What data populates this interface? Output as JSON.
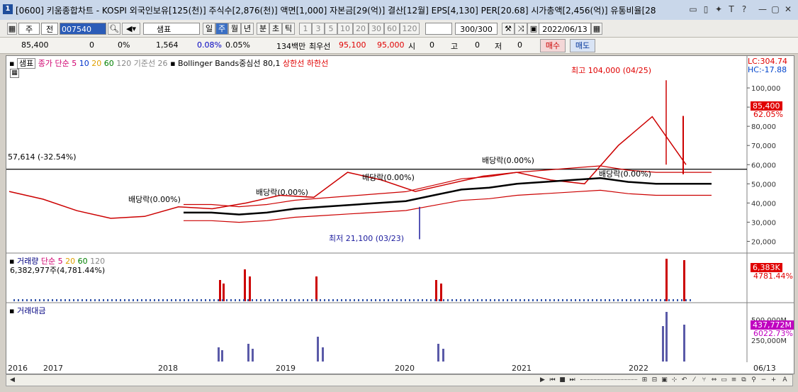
{
  "window": {
    "icon_label": "1",
    "title": "[0600] 키움종합차트 - KOSPI 외국인보유[125(천)] 주식수[2,876(천)] 액면[1,000] 자본금[29(억)] 결산[12월] EPS[4,130] PER[20.68] 시가총액[2,456(억)] 유통비율[28",
    "controls": [
      "▭",
      "▯",
      "✦",
      "T",
      "?",
      "—",
      "▢",
      "✕"
    ]
  },
  "toolbar": {
    "period_unit": "주",
    "prev_label": "전",
    "code": "007540",
    "name": "샘표",
    "period_buttons": [
      "일",
      "주",
      "월",
      "년"
    ],
    "time_buttons": [
      "분",
      "초",
      "틱"
    ],
    "number_buttons": [
      "1",
      "3",
      "5",
      "10",
      "20",
      "30",
      "60",
      "120"
    ],
    "count": "300/300",
    "date": "2022/06/13"
  },
  "quote": {
    "price": "85,400",
    "change": "0",
    "change_pct": "0%",
    "volume": "1,564",
    "vol_pct": "0.08%",
    "pct2": "0.05%",
    "amount": "134백만",
    "best_ask_label": "최우선",
    "best_ask": "95,100",
    "best_bid": "95,000",
    "open_label": "시",
    "open_val": "0",
    "high_label": "고",
    "high_val": "0",
    "low_label": "저",
    "low_val": "0",
    "buy_label": "매수",
    "sell_label": "매도"
  },
  "main_legend": {
    "name": "샘표",
    "ma_label": "종가 단순",
    "ma_periods": [
      "5",
      "10",
      "20",
      "60",
      "120"
    ],
    "base_label": "기준선 26",
    "bb_label": "Bollinger Bands중심선 80,1",
    "upper_label": "상한선",
    "lower_label": "하한선"
  },
  "annotations": {
    "high": "최고 104,000 (04/25)",
    "low": "최저 21,100 (03/23)",
    "hline": "57,614 (-32.54%)",
    "div1": "배당락(0.00%)",
    "div2": "배당락(0.00%)",
    "div3": "배당락(0.00%)",
    "div4": "배당락(0.00%)",
    "div5": "배당락(0.00%)"
  },
  "right_labels": {
    "lc": "LC:304.74",
    "hc": "HC:-17.88",
    "price_tag": "85,400",
    "price_pct": "62.05%",
    "vol_tag": "6,383K",
    "vol_pct": "4781.44%",
    "amt_tag": "437,772M",
    "amt_pct": "6022.73%"
  },
  "volume_panel": {
    "label": "거래량",
    "ma_label": "단순",
    "ma_periods": [
      "5",
      "20",
      "60",
      "120"
    ],
    "value": "6,382,977주(4,781.44%)"
  },
  "amount_panel": {
    "label": "거래대금"
  },
  "chart_data": {
    "type": "line",
    "title": "",
    "price_axis": [
      "100,000",
      "90,000",
      "80,000",
      "70,000",
      "60,000",
      "50,000",
      "40,000",
      "30,000",
      "20,000"
    ],
    "volume_axis": [],
    "amount_axis": [
      "500,000M",
      "250,000M"
    ],
    "x_labels": [
      "2016",
      "2017",
      "2018",
      "2019",
      "2020",
      "2021",
      "2022",
      "06/13"
    ],
    "series": [
      {
        "name": "종가",
        "values": [
          46000,
          42000,
          36000,
          32000,
          33000,
          38000,
          37000,
          40000,
          44000,
          43000,
          56000,
          52000,
          46000,
          50000,
          54000,
          56000,
          52000,
          50000,
          70000,
          85000,
          60000
        ]
      },
      {
        "name": "Bollinger Bands중심선 80,1",
        "values": [
          35000,
          35000,
          34000,
          35000,
          37000,
          38000,
          39000,
          40000,
          41000,
          44000,
          47000,
          48000,
          50000,
          51000,
          52000,
          53000,
          51000,
          50000,
          50000,
          50000
        ]
      }
    ],
    "ylim": [
      15000,
      110000
    ]
  }
}
